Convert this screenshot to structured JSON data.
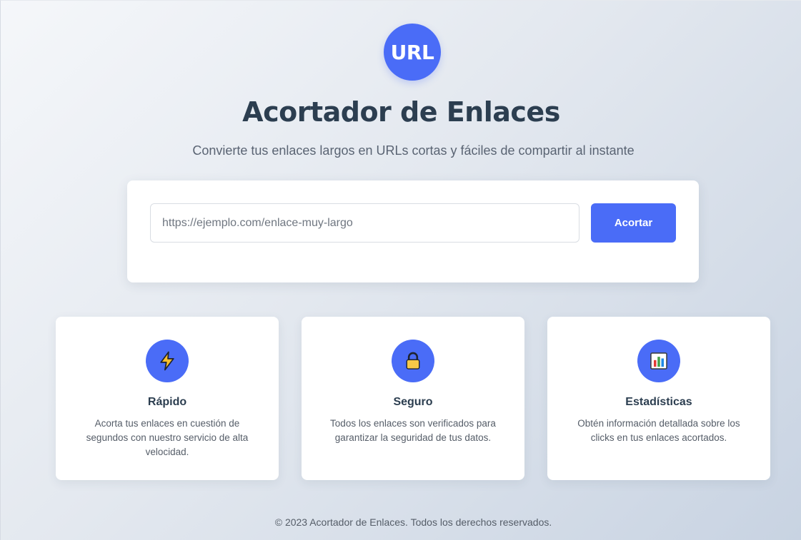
{
  "header": {
    "logo_text": "URL",
    "title": "Acortador de Enlaces",
    "subtitle": "Convierte tus enlaces largos en URLs cortas y fáciles de compartir al instante"
  },
  "form": {
    "input_placeholder": "https://ejemplo.com/enlace-muy-largo",
    "input_value": "",
    "button_label": "Acortar"
  },
  "features": [
    {
      "icon": "lightning-icon",
      "title": "Rápido",
      "description": "Acorta tus enlaces en cuestión de segundos con nuestro servicio de alta velocidad."
    },
    {
      "icon": "lock-icon",
      "title": "Seguro",
      "description": "Todos los enlaces son verificados para garantizar la seguridad de tus datos."
    },
    {
      "icon": "bar-chart-icon",
      "title": "Estadísticas",
      "description": "Obtén información detallada sobre los clicks en tus enlaces acortados."
    }
  ],
  "footer": {
    "text": "© 2023 Acortador de Enlaces. Todos los derechos reservados."
  },
  "colors": {
    "accent": "#4a6cf7",
    "heading": "#2c3e50",
    "text_muted": "#555d68",
    "card_bg": "#ffffff"
  }
}
